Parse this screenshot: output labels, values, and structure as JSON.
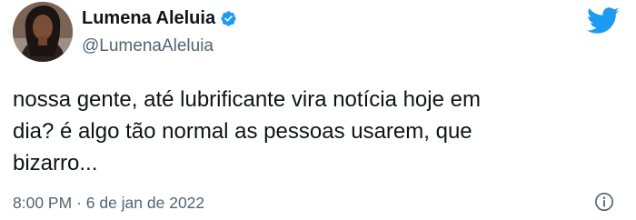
{
  "user": {
    "display_name": "Lumena Aleluia",
    "handle": "@LumenaAleluia",
    "verified": true
  },
  "tweet": {
    "text": "nossa gente, até lubrificante vira notícia hoje em\ndia? é algo tão normal as pessoas usarem, que\nbizarro...",
    "time": "8:00 PM",
    "separator": " · ",
    "date": "6 de jan de 2022"
  },
  "icons": {
    "verified": "verified-badge-icon",
    "logo": "twitter-bird-icon",
    "info": "info-icon"
  },
  "colors": {
    "brand_blue": "#1d9bf0",
    "text": "#0f1419",
    "secondary_text": "#536471"
  }
}
